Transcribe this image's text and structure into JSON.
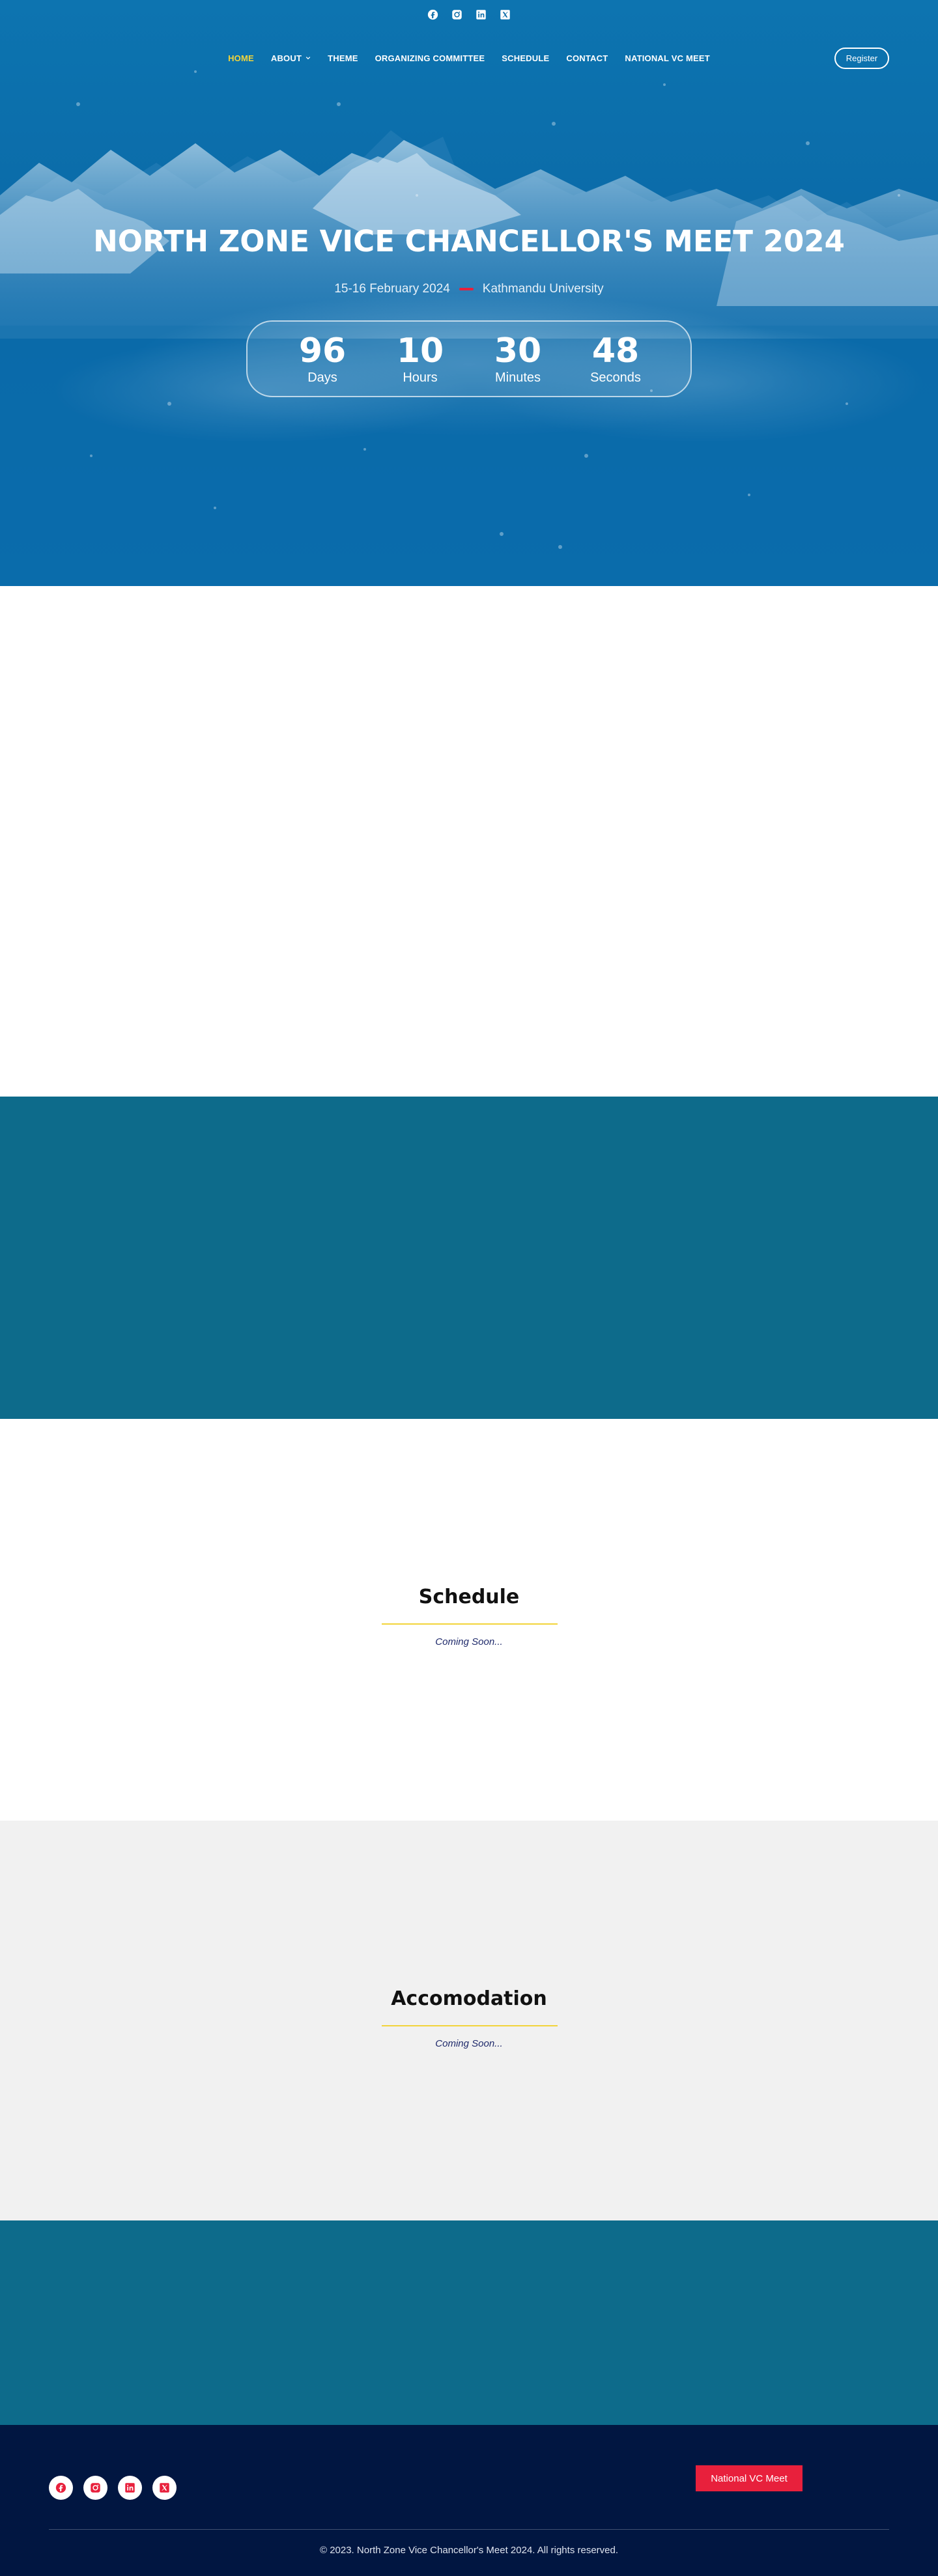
{
  "social": {
    "icons": [
      "facebook-icon",
      "instagram-icon",
      "linkedin-icon",
      "x-icon"
    ]
  },
  "nav": {
    "items": [
      {
        "label": "HOME",
        "active": true
      },
      {
        "label": "ABOUT",
        "dropdown": true
      },
      {
        "label": "THEME"
      },
      {
        "label": "ORGANIZING COMMITTEE"
      },
      {
        "label": "SCHEDULE"
      },
      {
        "label": "CONTACT"
      },
      {
        "label": "NATIONAL VC MEET"
      }
    ],
    "register_label": "Register"
  },
  "hero": {
    "title": "NORTH ZONE VICE CHANCELLOR'S MEET 2024",
    "date": "15-16 February 2024",
    "venue": "Kathmandu University",
    "countdown": [
      {
        "value": "96",
        "label": "Days"
      },
      {
        "value": "10",
        "label": "Hours"
      },
      {
        "value": "30",
        "label": "Minutes"
      },
      {
        "value": "48",
        "label": "Seconds"
      }
    ]
  },
  "schedule": {
    "heading": "Schedule",
    "status": "Coming Soon..."
  },
  "accommodation": {
    "heading": "Accomodation",
    "status": "Coming Soon..."
  },
  "footer": {
    "button_label": "National VC Meet",
    "copyright": "© 2023. North Zone Vice Chancellor's Meet 2024. All rights reserved."
  },
  "colors": {
    "accent_yellow": "#f2d43a",
    "accent_red": "#e8203c",
    "teal": "#0d6b8b",
    "footer_navy": "#011641"
  }
}
